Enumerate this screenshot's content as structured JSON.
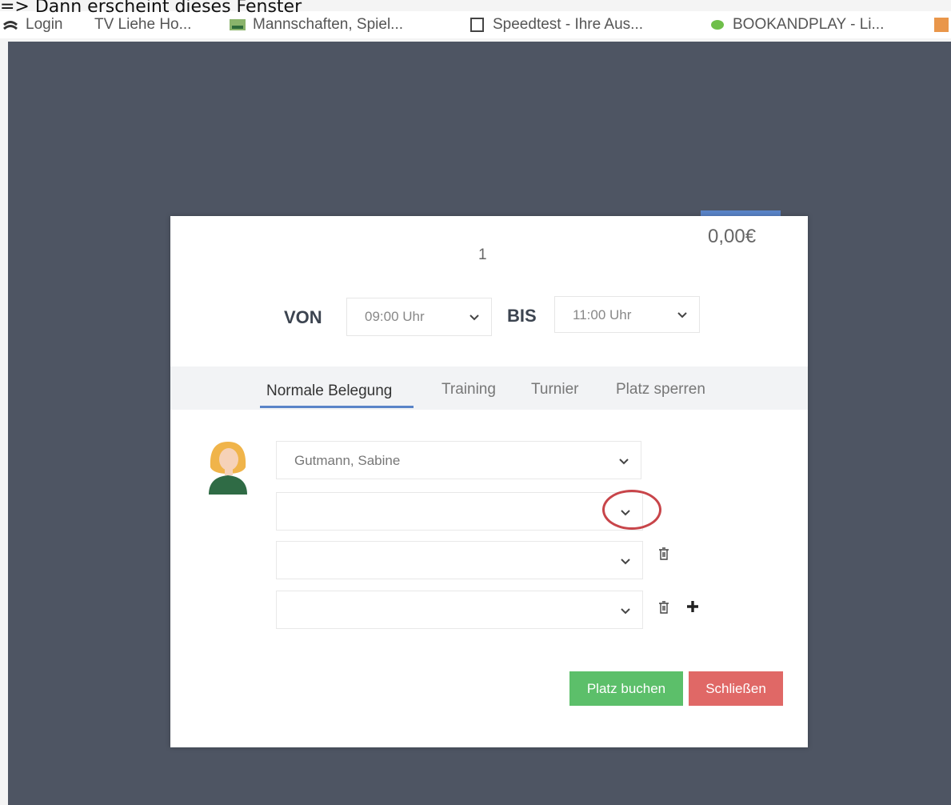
{
  "caption": "=> Dann erscheint dieses Fenster",
  "bookmarks": [
    {
      "label": "Login",
      "icon": "login-icon"
    },
    {
      "label": "TV Liehe Ho...",
      "icon": "page-icon"
    },
    {
      "label": "Mannschaften, Spiel...",
      "icon": "team-icon"
    },
    {
      "label": "Speedtest - Ihre Aus...",
      "icon": "page-icon"
    },
    {
      "label": "BOOKANDPLAY - Li...",
      "icon": "leaf-icon"
    }
  ],
  "modal": {
    "price": "0,00€",
    "court_number": "1",
    "from_label": "VON",
    "from_value": "09:00 Uhr",
    "to_label": "BIS",
    "to_value": "11:00 Uhr",
    "tabs": [
      {
        "label": "Normale Belegung",
        "active": true
      },
      {
        "label": "Training",
        "active": false
      },
      {
        "label": "Turnier",
        "active": false
      },
      {
        "label": "Platz sperren",
        "active": false
      }
    ],
    "players": [
      {
        "value": "Gutmann, Sabine",
        "delete": false,
        "add": false
      },
      {
        "value": "",
        "delete": false,
        "add": false
      },
      {
        "value": "",
        "delete": true,
        "add": false
      },
      {
        "value": "",
        "delete": true,
        "add": true
      }
    ],
    "book_button": "Platz buchen",
    "close_button": "Schließen"
  },
  "colors": {
    "backdrop": "#4e5563",
    "accent": "#5a84c8",
    "book": "#5cbf6a",
    "close": "#e06866",
    "highlight_circle": "#c8454a"
  }
}
